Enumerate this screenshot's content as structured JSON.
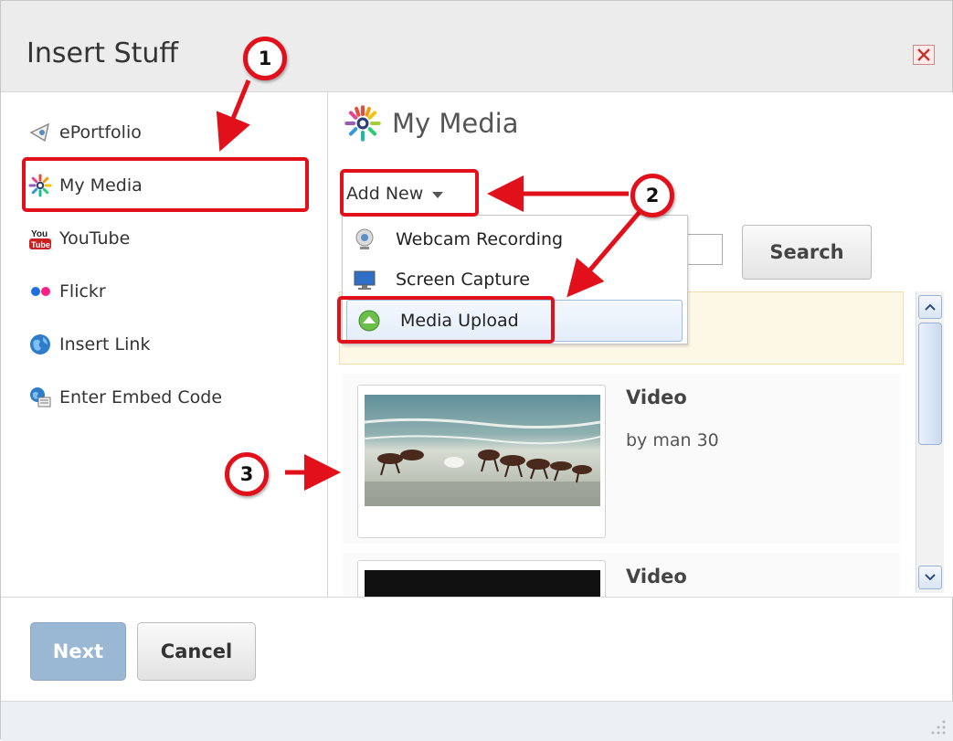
{
  "dialog": {
    "title": "Insert Stuff"
  },
  "sidebar": {
    "items": [
      {
        "label": "ePortfolio",
        "icon": "eportfolio-icon"
      },
      {
        "label": "My Media",
        "icon": "my-media-icon"
      },
      {
        "label": "YouTube",
        "icon": "youtube-icon"
      },
      {
        "label": "Flickr",
        "icon": "flickr-icon"
      },
      {
        "label": "Insert Link",
        "icon": "globe-icon"
      },
      {
        "label": "Enter Embed Code",
        "icon": "embed-code-icon"
      }
    ]
  },
  "main": {
    "heading": "My Media",
    "add_new_label": "Add New",
    "search_button": "Search",
    "dropdown": [
      {
        "label": "Webcam Recording",
        "icon": "webcam-icon"
      },
      {
        "label": "Screen Capture",
        "icon": "monitor-icon"
      },
      {
        "label": "Media Upload",
        "icon": "upload-icon"
      }
    ],
    "media_items": [
      {
        "title": "Video",
        "author": "by man 30"
      },
      {
        "title": "Video",
        "author": ""
      }
    ]
  },
  "footer": {
    "next_label": "Next",
    "cancel_label": "Cancel"
  },
  "callouts": [
    "1",
    "2",
    "3"
  ],
  "colors": {
    "callout_red": "#e2101a",
    "next_button": "#9ab7d4",
    "notice_bg": "#fdf7e6"
  }
}
